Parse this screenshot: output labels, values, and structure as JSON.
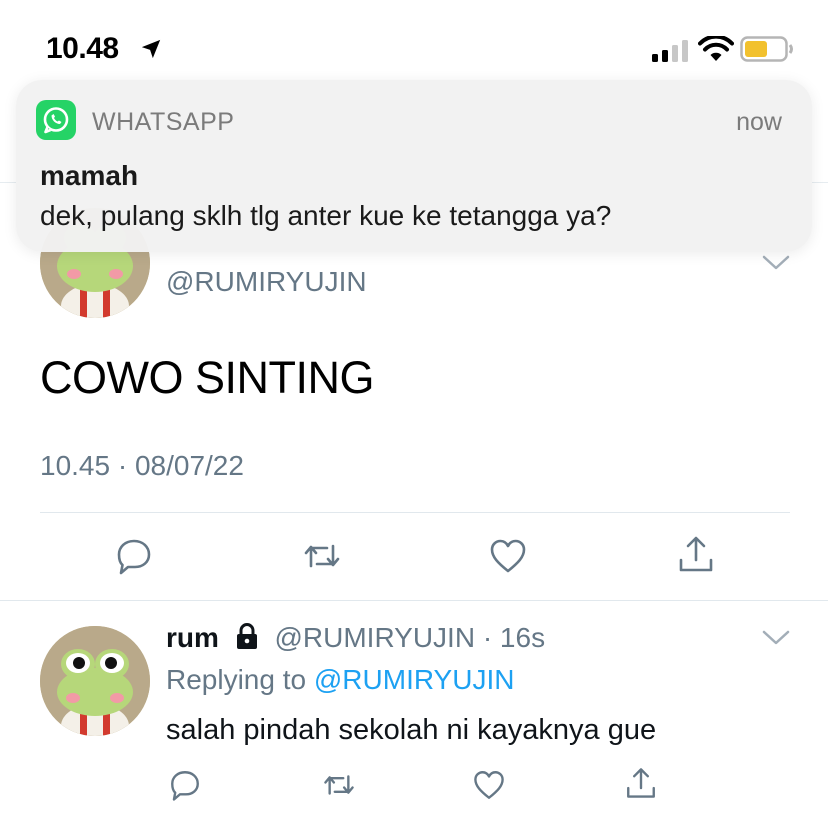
{
  "status_bar": {
    "time": "10.48",
    "icons": [
      "location-arrow-icon",
      "cellular-signal-icon",
      "wifi-icon",
      "battery-icon"
    ],
    "battery_color": "#f2c12e"
  },
  "notification": {
    "app_icon": "whatsapp-icon",
    "app_name": "WHATSAPP",
    "time": "now",
    "title": "mamah",
    "body": "dek, pulang sklh tlg anter kue ke tetangga ya?",
    "brand_color": "#25d366"
  },
  "main_tweet": {
    "handle": "@RUMIRYUJIN",
    "text": "COWO SINTING",
    "timestamp": "10.45 · 08/07/22",
    "actions": [
      "reply-icon",
      "retweet-icon",
      "like-icon",
      "share-icon"
    ]
  },
  "reply_tweet": {
    "name": "rum",
    "handle_meta": "@RUMIRYUJIN · 16s",
    "replying_prefix": "Replying to ",
    "replying_handle": "@RUMIRYUJIN",
    "text": "salah pindah sekolah ni kayaknya gue",
    "actions": [
      "reply-icon",
      "retweet-icon",
      "like-icon",
      "share-icon"
    ]
  },
  "colors": {
    "link": "#1da1f2",
    "secondary_text": "#657786",
    "icon": "#657786"
  }
}
